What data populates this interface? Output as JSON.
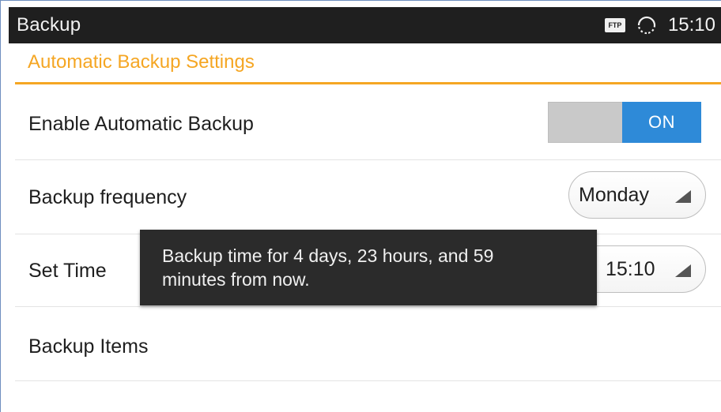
{
  "status_bar": {
    "title": "Backup",
    "ftp_label": "FTP",
    "time": "15:10",
    "icons": [
      "ftp-icon",
      "sync-icon"
    ]
  },
  "section": {
    "header": "Automatic Backup Settings",
    "accent_color": "#f5a623"
  },
  "settings": {
    "enable_auto_backup": {
      "label": "Enable Automatic Backup",
      "toggle_state": "ON",
      "toggle_color": "#2e8ad8"
    },
    "backup_frequency": {
      "label": "Backup frequency",
      "value": "Monday"
    },
    "set_time": {
      "label": "Set Time",
      "value": "15:10"
    },
    "backup_items": {
      "label": "Backup Items"
    }
  },
  "tooltip": {
    "text_line1": "Backup time for 4 days, 23 hours, and 59",
    "text_line2": "minutes from now."
  }
}
